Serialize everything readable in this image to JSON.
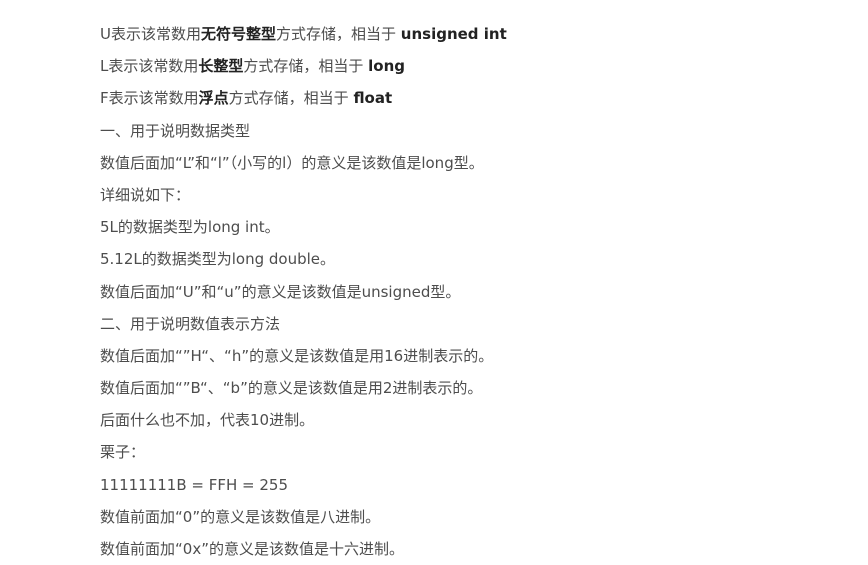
{
  "lines": [
    {
      "a": "U表示该常数用",
      "b": "无符号整型",
      "c": "方式存储，相当于 ",
      "d": "unsigned int"
    },
    {
      "a": "L表示该常数用",
      "b": "长整型",
      "c": "方式存储，相当于 ",
      "d": "long"
    },
    {
      "a": "F表示该常数用",
      "b": "浮点",
      "c": "方式存储，相当于 ",
      "d": "float"
    },
    {
      "a": "一、用于说明数据类型"
    },
    {
      "a": "数值后面加“L”和“l”（小写的l）的意义是该数值是long型。"
    },
    {
      "a": "详细说如下："
    },
    {
      "a": "5L的数据类型为long int。"
    },
    {
      "a": "5.12L的数据类型为long double。"
    },
    {
      "a": "数值后面加“U”和“u”的意义是该数值是unsigned型。"
    },
    {
      "a": "二、用于说明数值表示方法"
    },
    {
      "a": "数值后面加“”H“、“h”的意义是该数值是用16进制表示的。"
    },
    {
      "a": "数值后面加“”B“、“b”的意义是该数值是用2进制表示的。"
    },
    {
      "a": "后面什么也不加，代表10进制。"
    },
    {
      "a": "栗子："
    },
    {
      "a": "11111111B = FFH = 255"
    },
    {
      "a": "数值前面加“0”的意义是该数值是八进制。"
    },
    {
      "a": "数值前面加“0x”的意义是该数值是十六进制。"
    }
  ]
}
